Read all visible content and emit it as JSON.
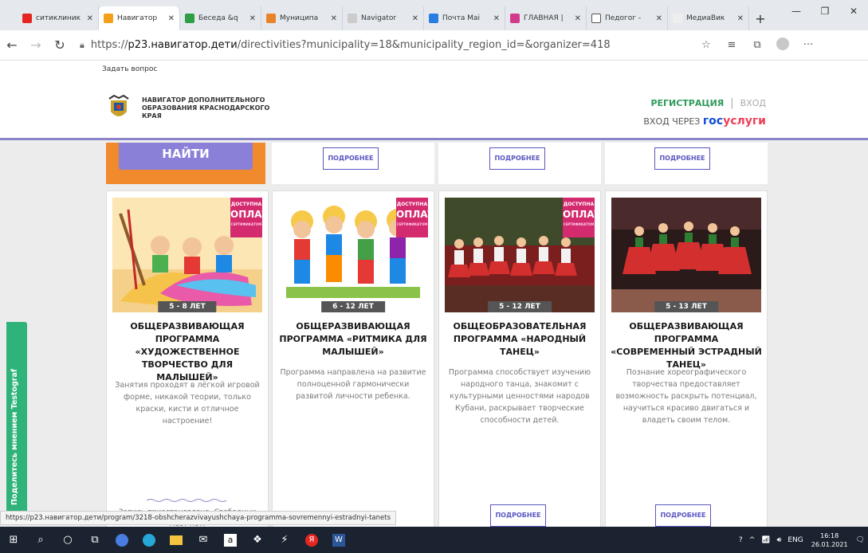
{
  "browser": {
    "tabs": [
      {
        "label": "ситиклиник",
        "color": "#e52620"
      },
      {
        "label": "Навигатор",
        "color": "#f2a21a"
      },
      {
        "label": "Беседа &q",
        "color": "#2f9e44"
      },
      {
        "label": "Муниципа",
        "color": "#e8832a"
      },
      {
        "label": "Navigator",
        "color": "#cccccc"
      },
      {
        "label": "Почта Mai",
        "color": "#2a7de1"
      },
      {
        "label": "ГЛАВНАЯ |",
        "color": "#d43a8c"
      },
      {
        "label": "Педогог -",
        "color": "#ffffff"
      },
      {
        "label": "МедиаВик",
        "color": "#eeeeee"
      }
    ],
    "url_prefix": "https://",
    "url_host": "p23.навигатор.дети",
    "url_path": "/directivities?municipality=18&municipality_region_id=&organizer=418"
  },
  "site": {
    "ask": "Задать вопрос",
    "brand": "НАВИГАТОР ДОПОЛНИТЕЛЬНОГО ОБРАЗОВАНИЯ КРАСНОДАРСКОГО КРАЯ",
    "register": "РЕГИСТРАЦИЯ",
    "login": "ВХОД",
    "login_via": "ВХОД ЧЕРЕЗ",
    "gos1": "гос",
    "gos2": "услуги"
  },
  "search_button": "НАЙТИ",
  "more_label": "ПОДРОБНЕЕ",
  "badge": {
    "line1": "ДОСТУПНА",
    "line2": "ОПЛАТА",
    "line3": "СЕРТИФИКАТОМ"
  },
  "cards": [
    {
      "age": "5 - 8 ЛЕТ",
      "title": "ОБЩЕРАЗВИВАЮЩАЯ ПРОГРАММА «ХУДОЖЕСТВЕННОЕ ТВОРЧЕСТВО ДЛЯ МАЛЫШЕЙ»",
      "desc": "Занятия проходят в лёгкой игровой форме, никакой теории, только краски, кисти и отличное настроение!",
      "note": "Запись приостановлена. Свободных мест нет."
    },
    {
      "age": "6 - 12 ЛЕТ",
      "title": "ОБЩЕРАЗВИВАЮЩАЯ ПРОГРАММА «РИТМИКА ДЛЯ МАЛЫШЕЙ»",
      "desc": "Программа направлена на развитие полноценной гармонически развитой личности ребенка."
    },
    {
      "age": "5 - 12 ЛЕТ",
      "title": "ОБЩЕОБРАЗОВАТЕЛЬНАЯ ПРОГРАММА «НАРОДНЫЙ ТАНЕЦ»",
      "desc": "Программа способствует изучению народного танца, знакомит с культурными ценностями народов Кубани, раскрывает творческие способности детей."
    },
    {
      "age": "5 - 13 ЛЕТ",
      "title": "ОБЩЕРАЗВИВАЮЩАЯ ПРОГРАММА «СОВРЕМЕННЫЙ ЭСТРАДНЫЙ ТАНЕЦ»",
      "desc": "Познание хореографического творчества предоставляет возможность раскрыть потенциал, научиться красиво двигаться и владеть своим телом."
    }
  ],
  "side_widget": "Поделитесь мнением  Testograf",
  "status_url": "https://p23.навигатор.дети/program/3218-obshcherazvivayushchaya-programma-sovremennyi-estradnyi-tanets",
  "taskbar": {
    "lang": "ENG",
    "time": "16:18",
    "date": "26.01.2021"
  }
}
